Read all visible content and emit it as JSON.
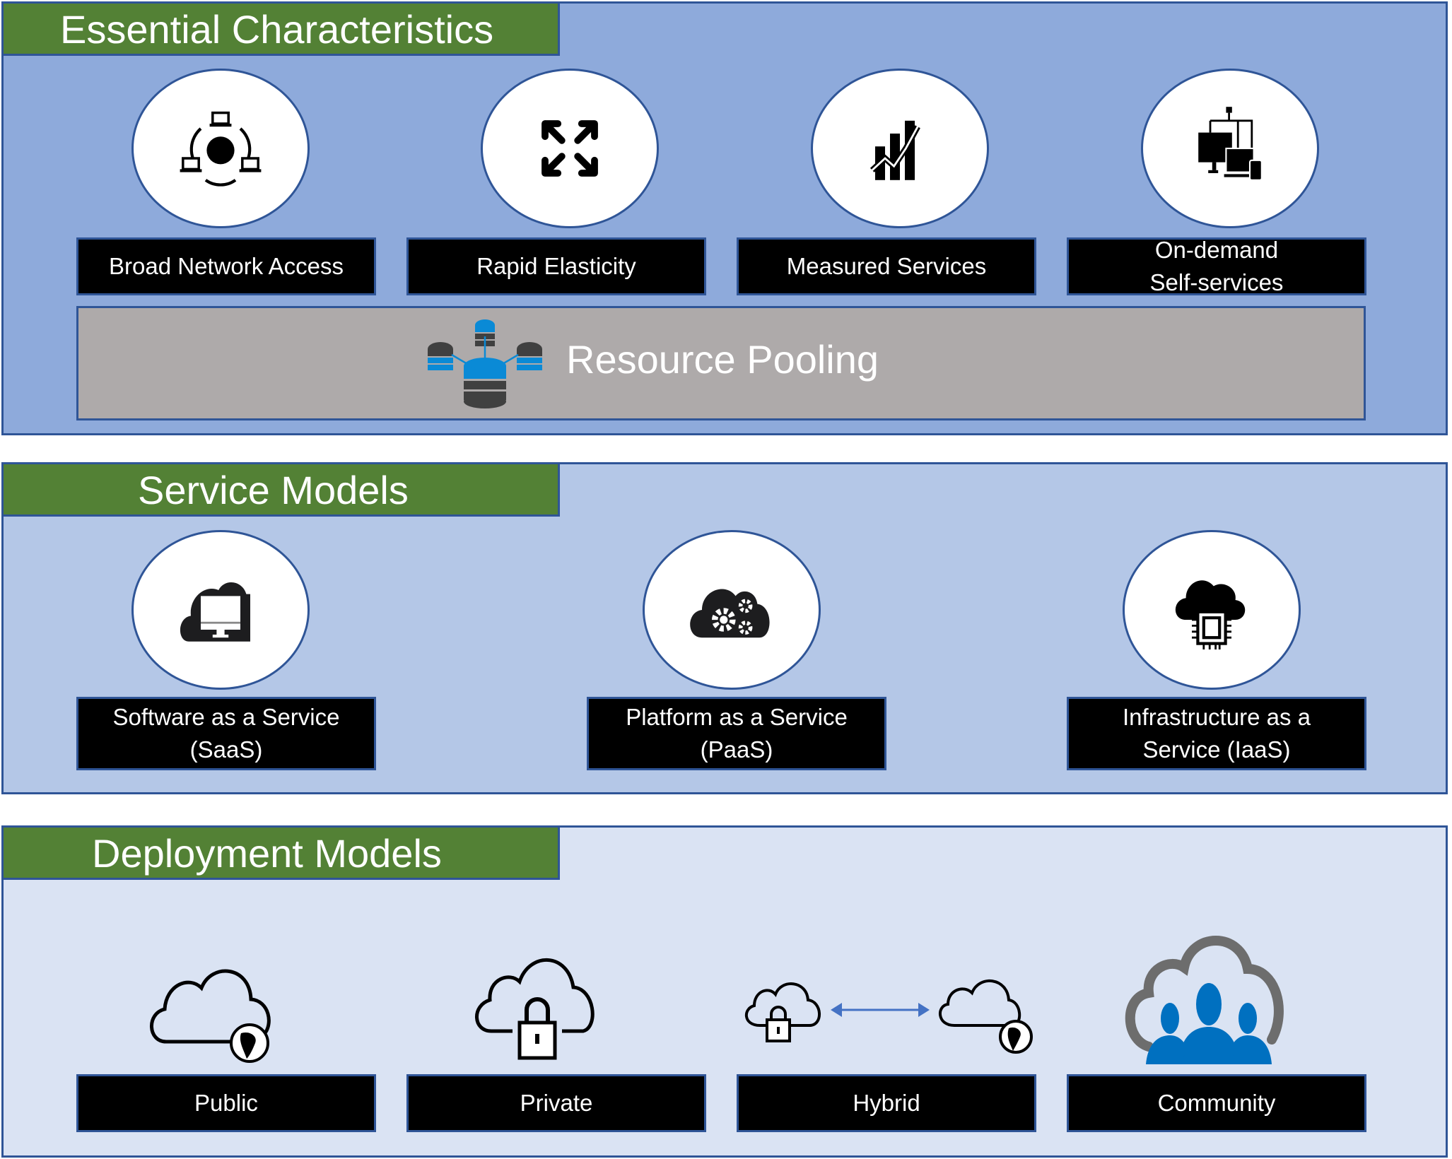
{
  "essential": {
    "title": "Essential Characteristics",
    "items": [
      {
        "label_lines": [
          "Broad Network Access"
        ],
        "icon": "network-globe-icon"
      },
      {
        "label_lines": [
          "Rapid Elasticity"
        ],
        "icon": "expand-arrows-icon"
      },
      {
        "label_lines": [
          "Measured Services"
        ],
        "icon": "bar-chart-trend-icon"
      },
      {
        "label_lines": [
          "On-demand",
          "Self-services"
        ],
        "icon": "multi-device-icon"
      }
    ],
    "pool": {
      "label": "Resource Pooling",
      "icon": "database-pool-icon"
    }
  },
  "service": {
    "title": "Service Models",
    "items": [
      {
        "label_lines": [
          "Software as a Service",
          "(SaaS)"
        ],
        "icon": "cloud-monitor-icon"
      },
      {
        "label_lines": [
          "Platform as a Service",
          "(PaaS)"
        ],
        "icon": "cloud-gears-icon"
      },
      {
        "label_lines": [
          "Infrastructure as a",
          "Service (IaaS)"
        ],
        "icon": "cloud-chip-icon"
      }
    ]
  },
  "deployment": {
    "title": "Deployment Models",
    "items": [
      {
        "label_lines": [
          "Public"
        ],
        "icon": "cloud-globe-icon"
      },
      {
        "label_lines": [
          "Private"
        ],
        "icon": "cloud-lock-icon"
      },
      {
        "label_lines": [
          "Hybrid"
        ],
        "icon": "hybrid-clouds-icon"
      },
      {
        "label_lines": [
          "Community"
        ],
        "icon": "cloud-people-icon"
      }
    ]
  },
  "colors": {
    "header_green": "#538135",
    "border_blue": "#2f5597",
    "essential_bg": "#8eaadb",
    "service_bg": "#b4c7e7",
    "deployment_bg": "#dae3f3",
    "pool_gray": "#aeaaaa",
    "accent_blue": "#0070c0",
    "arrow_blue": "#4472c4"
  }
}
